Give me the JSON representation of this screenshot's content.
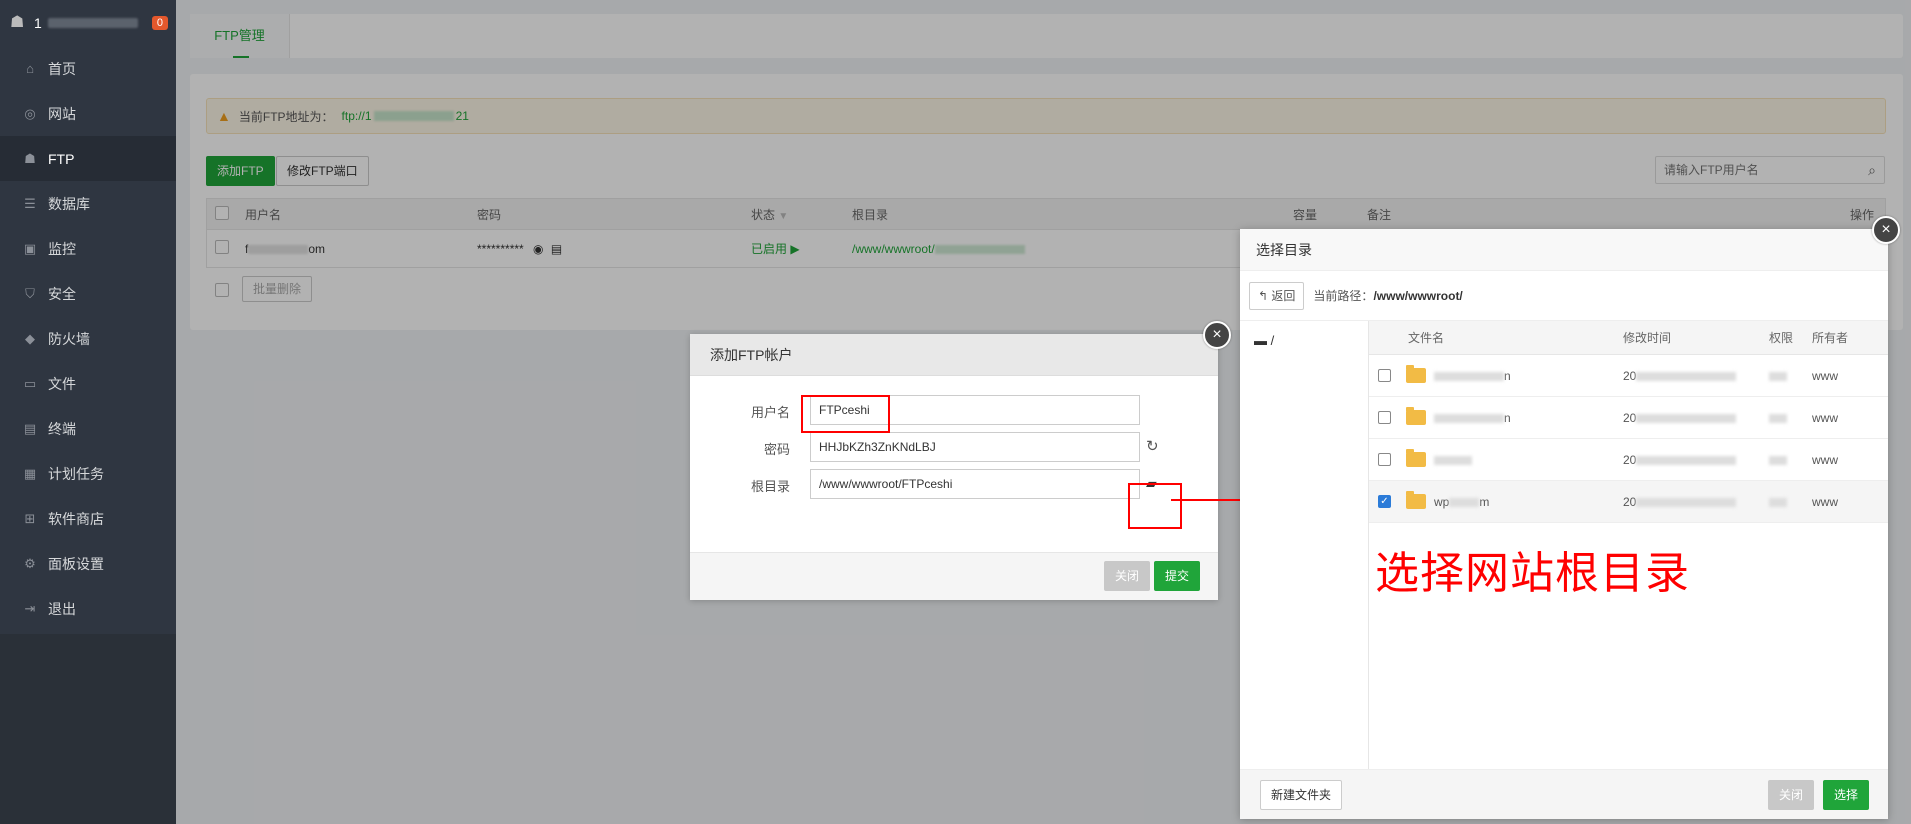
{
  "sidebar": {
    "host_prefix": "1",
    "badge": "0",
    "items": [
      {
        "label": "首页",
        "icon": "home-icon",
        "glyph": "⌂"
      },
      {
        "label": "网站",
        "icon": "globe-icon",
        "glyph": "◎"
      },
      {
        "label": "FTP",
        "icon": "ftp-icon",
        "glyph": "☗"
      },
      {
        "label": "数据库",
        "icon": "database-icon",
        "glyph": "☰"
      },
      {
        "label": "监控",
        "icon": "monitor-icon",
        "glyph": "▣"
      },
      {
        "label": "安全",
        "icon": "shield-icon",
        "glyph": "⛉"
      },
      {
        "label": "防火墙",
        "icon": "firewall-icon",
        "glyph": "◆"
      },
      {
        "label": "文件",
        "icon": "folder-icon",
        "glyph": "▭"
      },
      {
        "label": "终端",
        "icon": "terminal-icon",
        "glyph": "▤"
      },
      {
        "label": "计划任务",
        "icon": "calendar-icon",
        "glyph": "▦"
      },
      {
        "label": "软件商店",
        "icon": "apps-icon",
        "glyph": "⊞"
      },
      {
        "label": "面板设置",
        "icon": "settings-icon",
        "glyph": "⚙"
      },
      {
        "label": "退出",
        "icon": "logout-icon",
        "glyph": "⇥"
      }
    ]
  },
  "tabs": {
    "active": "FTP管理"
  },
  "notice": {
    "label": "当前FTP地址为：",
    "addr_prefix": "ftp://1",
    "addr_suffix": "21"
  },
  "toolbar": {
    "add_ftp": "添加FTP",
    "modify_port": "修改FTP端口"
  },
  "search": {
    "placeholder": "请输入FTP用户名"
  },
  "table": {
    "headers": {
      "username": "用户名",
      "password": "密码",
      "status": "状态",
      "root": "根目录",
      "capacity": "容量",
      "remark": "备注",
      "ops": "操作"
    },
    "row": {
      "username_prefix": "f",
      "username_suffix": "om",
      "password": "**********",
      "status": "已启用",
      "root_prefix": "/www/wwwroot/"
    },
    "batch_delete": "批量删除"
  },
  "add_modal": {
    "title": "添加FTP帐户",
    "username_label": "用户名",
    "username_value": "FTPceshi",
    "password_label": "密码",
    "password_value": "HHJbKZh3ZnKNdLBJ",
    "root_label": "根目录",
    "root_value": "/www/wwwroot/FTPceshi",
    "close_btn": "关闭",
    "submit_btn": "提交"
  },
  "dir_modal": {
    "title": "选择目录",
    "back_btn": "返回",
    "path_label": "当前路径：",
    "path_value": "/www/wwwroot/",
    "tree_root": "/",
    "headers": {
      "name": "文件名",
      "mtime": "修改时间",
      "perm": "权限",
      "owner": "所有者"
    },
    "rows": [
      {
        "name_prefix": "",
        "name_suffix": "n",
        "mtime_prefix": "20",
        "owner": "www",
        "checked": false
      },
      {
        "name_prefix": "",
        "name_suffix": "n",
        "mtime_prefix": "20",
        "owner": "www",
        "checked": false
      },
      {
        "name_prefix": "",
        "name_suffix": "",
        "mtime_prefix": "20",
        "owner": "www",
        "checked": false
      },
      {
        "name_prefix": "wp",
        "name_suffix": "m",
        "mtime_prefix": "20",
        "owner": "www",
        "checked": true
      }
    ],
    "new_folder_btn": "新建文件夹",
    "close_btn": "关闭",
    "select_btn": "选择"
  },
  "annotation": {
    "text": "选择网站根目录",
    "color": "#ff0000"
  },
  "colors": {
    "brand_green": "#20a53a",
    "sidebar_bg": "#2f3641",
    "badge": "#e4582c"
  }
}
